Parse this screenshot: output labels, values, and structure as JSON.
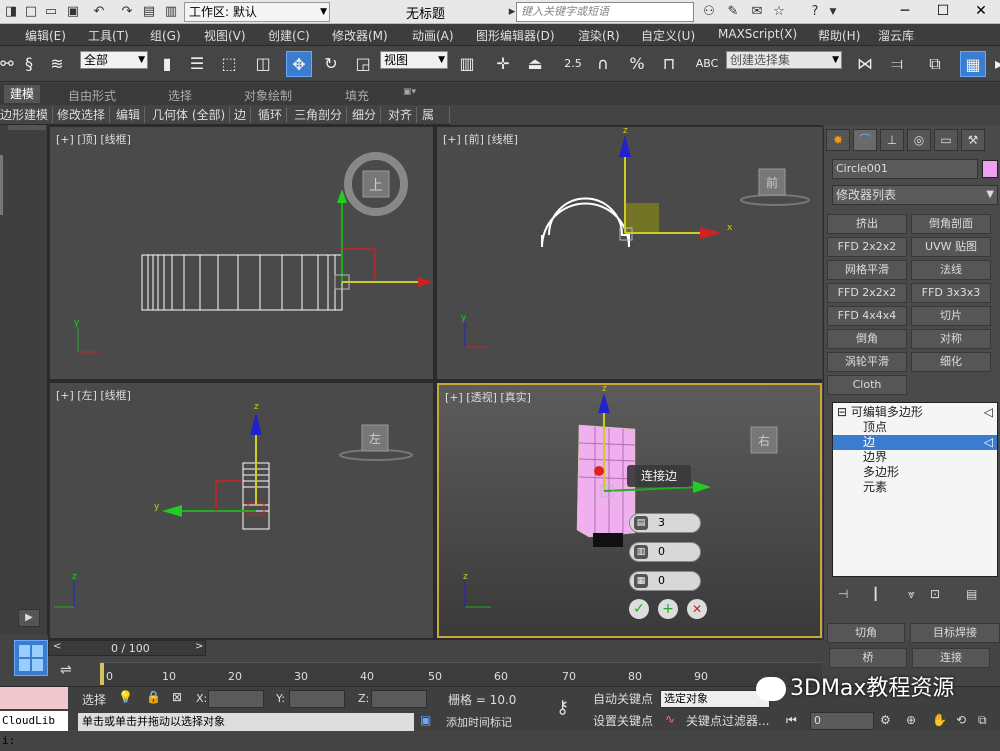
{
  "titlebar": {
    "workspace": "工作区: 默认",
    "doc_title": "无标题",
    "search_placeholder": "键入关键字或短语"
  },
  "menu": [
    "编辑(E)",
    "工具(T)",
    "组(G)",
    "视图(V)",
    "创建(C)",
    "修改器(M)",
    "动画(A)",
    "图形编辑器(D)",
    "渲染(R)",
    "自定义(U)",
    "MAXScript(X)",
    "帮助(H)",
    "溜云库"
  ],
  "toolbar": {
    "filter_select": "全部",
    "view_select": "视图",
    "selection_set": "创建选择集",
    "snap_angle": "2.5"
  },
  "ribbon": {
    "tabs": [
      "建模",
      "自由形式",
      "选择",
      "对象绘制",
      "填充"
    ],
    "sub": [
      "边形建模",
      "修改选择",
      "编辑",
      "几何体 (全部)",
      "边",
      "循环",
      "三角剖分",
      "细分",
      "对齐",
      "属性"
    ]
  },
  "viewports": {
    "top": {
      "label": "[+] [顶] [线框]",
      "cube": "上"
    },
    "front": {
      "label": "[+] [前] [线框]",
      "cube": "前"
    },
    "left": {
      "label": "[+] [左] [线框]",
      "cube": "左"
    },
    "persp": {
      "label": "[+] [透视] [真实]",
      "cube": "右",
      "caddy_title": "连接边",
      "caddy_segments": "3",
      "caddy_pinch": "0",
      "caddy_slide": "0"
    }
  },
  "axes": {
    "x": "x",
    "y": "y",
    "z": "z"
  },
  "command_panel": {
    "object_name": "Circle001",
    "object_color": "#f0a0f0",
    "modifier_list": "修改器列表",
    "buttons": [
      "挤出",
      "倒角剖面",
      "FFD 2x2x2",
      "UVW 贴图",
      "网格平滑",
      "法线",
      "FFD 2x2x2",
      "FFD 3x3x3",
      "FFD 4x4x4",
      "切片",
      "倒角",
      "对称",
      "涡轮平滑",
      "细化",
      "Cloth"
    ],
    "stack": [
      "可编辑多边形",
      "顶点",
      "边",
      "边界",
      "多边形",
      "元素"
    ],
    "bottom_buttons": [
      "切角",
      "目标焊接",
      "桥",
      "连接"
    ]
  },
  "timeline": {
    "frame": "0 / 100",
    "ticks": [
      "0",
      "10",
      "20",
      "30",
      "40",
      "50",
      "60",
      "70",
      "80",
      "90"
    ]
  },
  "statusbar": {
    "cloudlib": "CloudLib i:",
    "select_label": "选择",
    "x_label": "X:",
    "y_label": "Y:",
    "z_label": "Z:",
    "grid": "栅格 = 10.0",
    "autokey": "自动关键点",
    "setkey": "设置关键点",
    "selected_object": "选定对象",
    "key_filters": "关键点过滤器...",
    "hint": "单击或单击并拖动以选择对象",
    "add_time_tag": "添加时间标记",
    "current_frame": "0"
  },
  "watermark": "3DMax教程资源"
}
